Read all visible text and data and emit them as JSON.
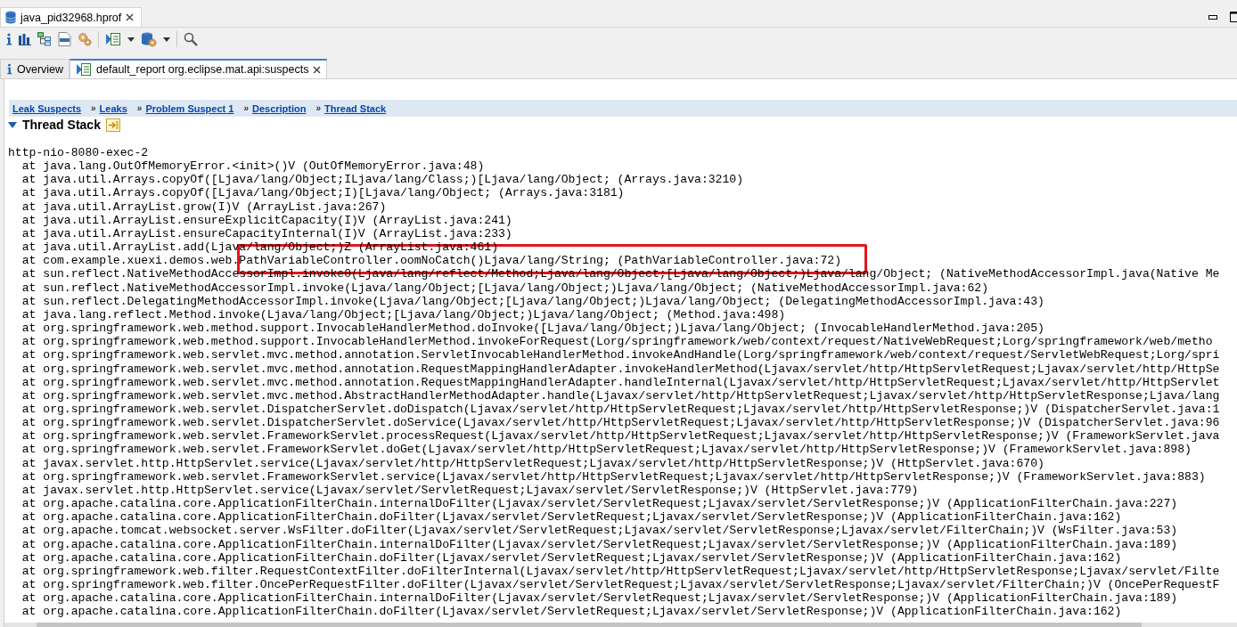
{
  "editor_tabs": [
    {
      "label": "java_pid32968.hprof",
      "selected": true
    }
  ],
  "view_tabs": [
    {
      "label": "Overview",
      "selected": false,
      "kind": "info"
    },
    {
      "label": "default_report org.eclipse.mat.api:suspects",
      "selected": true,
      "kind": "report"
    }
  ],
  "breadcrumb": [
    {
      "label": "Leak Suspects"
    },
    {
      "separator": "»",
      "label": "Leaks"
    },
    {
      "separator": "»",
      "label": "Problem Suspect 1"
    },
    {
      "separator": "»",
      "label": "Description"
    },
    {
      "separator": "»",
      "label": "Thread Stack"
    }
  ],
  "section": {
    "title": "Thread Stack",
    "expanded": true
  },
  "thread_name": "http-nio-8080-exec-2",
  "stack": [
    "at java.lang.OutOfMemoryError.<init>()V (OutOfMemoryError.java:48)",
    "at java.util.Arrays.copyOf([Ljava/lang/Object;ILjava/lang/Class;)[Ljava/lang/Object; (Arrays.java:3210)",
    "at java.util.Arrays.copyOf([Ljava/lang/Object;I)[Ljava/lang/Object; (Arrays.java:3181)",
    "at java.util.ArrayList.grow(I)V (ArrayList.java:267)",
    "at java.util.ArrayList.ensureExplicitCapacity(I)V (ArrayList.java:241)",
    "at java.util.ArrayList.ensureCapacityInternal(I)V (ArrayList.java:233)",
    "at java.util.ArrayList.add(Ljava/lang/Object;)Z (ArrayList.java:461)",
    "at com.example.xuexi.demos.web.PathVariableController.oomNoCatch()Ljava/lang/String; (PathVariableController.java:72)",
    "at sun.reflect.NativeMethodAccessorImpl.invoke0(Ljava/lang/reflect/Method;Ljava/lang/Object;[Ljava/lang/Object;)Ljava/lang/Object; (NativeMethodAccessorImpl.java(Native Me",
    "at sun.reflect.NativeMethodAccessorImpl.invoke(Ljava/lang/Object;[Ljava/lang/Object;)Ljava/lang/Object; (NativeMethodAccessorImpl.java:62)",
    "at sun.reflect.DelegatingMethodAccessorImpl.invoke(Ljava/lang/Object;[Ljava/lang/Object;)Ljava/lang/Object; (DelegatingMethodAccessorImpl.java:43)",
    "at java.lang.reflect.Method.invoke(Ljava/lang/Object;[Ljava/lang/Object;)Ljava/lang/Object; (Method.java:498)",
    "at org.springframework.web.method.support.InvocableHandlerMethod.doInvoke([Ljava/lang/Object;)Ljava/lang/Object; (InvocableHandlerMethod.java:205)",
    "at org.springframework.web.method.support.InvocableHandlerMethod.invokeForRequest(Lorg/springframework/web/context/request/NativeWebRequest;Lorg/springframework/web/metho",
    "at org.springframework.web.servlet.mvc.method.annotation.ServletInvocableHandlerMethod.invokeAndHandle(Lorg/springframework/web/context/request/ServletWebRequest;Lorg/spri",
    "at org.springframework.web.servlet.mvc.method.annotation.RequestMappingHandlerAdapter.invokeHandlerMethod(Ljavax/servlet/http/HttpServletRequest;Ljavax/servlet/http/HttpSe",
    "at org.springframework.web.servlet.mvc.method.annotation.RequestMappingHandlerAdapter.handleInternal(Ljavax/servlet/http/HttpServletRequest;Ljavax/servlet/http/HttpServlet",
    "at org.springframework.web.servlet.mvc.method.AbstractHandlerMethodAdapter.handle(Ljavax/servlet/http/HttpServletRequest;Ljavax/servlet/http/HttpServletResponse;Ljava/lang",
    "at org.springframework.web.servlet.DispatcherServlet.doDispatch(Ljavax/servlet/http/HttpServletRequest;Ljavax/servlet/http/HttpServletResponse;)V (DispatcherServlet.java:1",
    "at org.springframework.web.servlet.DispatcherServlet.doService(Ljavax/servlet/http/HttpServletRequest;Ljavax/servlet/http/HttpServletResponse;)V (DispatcherServlet.java:96",
    "at org.springframework.web.servlet.FrameworkServlet.processRequest(Ljavax/servlet/http/HttpServletRequest;Ljavax/servlet/http/HttpServletResponse;)V (FrameworkServlet.java",
    "at org.springframework.web.servlet.FrameworkServlet.doGet(Ljavax/servlet/http/HttpServletRequest;Ljavax/servlet/http/HttpServletResponse;)V (FrameworkServlet.java:898)",
    "at javax.servlet.http.HttpServlet.service(Ljavax/servlet/http/HttpServletRequest;Ljavax/servlet/http/HttpServletResponse;)V (HttpServlet.java:670)",
    "at org.springframework.web.servlet.FrameworkServlet.service(Ljavax/servlet/http/HttpServletRequest;Ljavax/servlet/http/HttpServletResponse;)V (FrameworkServlet.java:883)",
    "at javax.servlet.http.HttpServlet.service(Ljavax/servlet/ServletRequest;Ljavax/servlet/ServletResponse;)V (HttpServlet.java:779)",
    "at org.apache.catalina.core.ApplicationFilterChain.internalDoFilter(Ljavax/servlet/ServletRequest;Ljavax/servlet/ServletResponse;)V (ApplicationFilterChain.java:227)",
    "at org.apache.catalina.core.ApplicationFilterChain.doFilter(Ljavax/servlet/ServletRequest;Ljavax/servlet/ServletResponse;)V (ApplicationFilterChain.java:162)",
    "at org.apache.tomcat.websocket.server.WsFilter.doFilter(Ljavax/servlet/ServletRequest;Ljavax/servlet/ServletResponse;Ljavax/servlet/FilterChain;)V (WsFilter.java:53)",
    "at org.apache.catalina.core.ApplicationFilterChain.internalDoFilter(Ljavax/servlet/ServletRequest;Ljavax/servlet/ServletResponse;)V (ApplicationFilterChain.java:189)",
    "at org.apache.catalina.core.ApplicationFilterChain.doFilter(Ljavax/servlet/ServletRequest;Ljavax/servlet/ServletResponse;)V (ApplicationFilterChain.java:162)",
    "at org.springframework.web.filter.RequestContextFilter.doFilterInternal(Ljavax/servlet/http/HttpServletRequest;Ljavax/servlet/http/HttpServletResponse;Ljavax/servlet/Filte",
    "at org.springframework.web.filter.OncePerRequestFilter.doFilter(Ljavax/servlet/ServletRequest;Ljavax/servlet/ServletResponse;Ljavax/servlet/FilterChain;)V (OncePerRequestF",
    "at org.apache.catalina.core.ApplicationFilterChain.internalDoFilter(Ljavax/servlet/ServletRequest;Ljavax/servlet/ServletResponse;)V (ApplicationFilterChain.java:189)",
    "at org.apache.catalina.core.ApplicationFilterChain.doFilter(Ljavax/servlet/ServletRequest;Ljavax/servlet/ServletResponse;)V (ApplicationFilterChain.java:162)"
  ]
}
